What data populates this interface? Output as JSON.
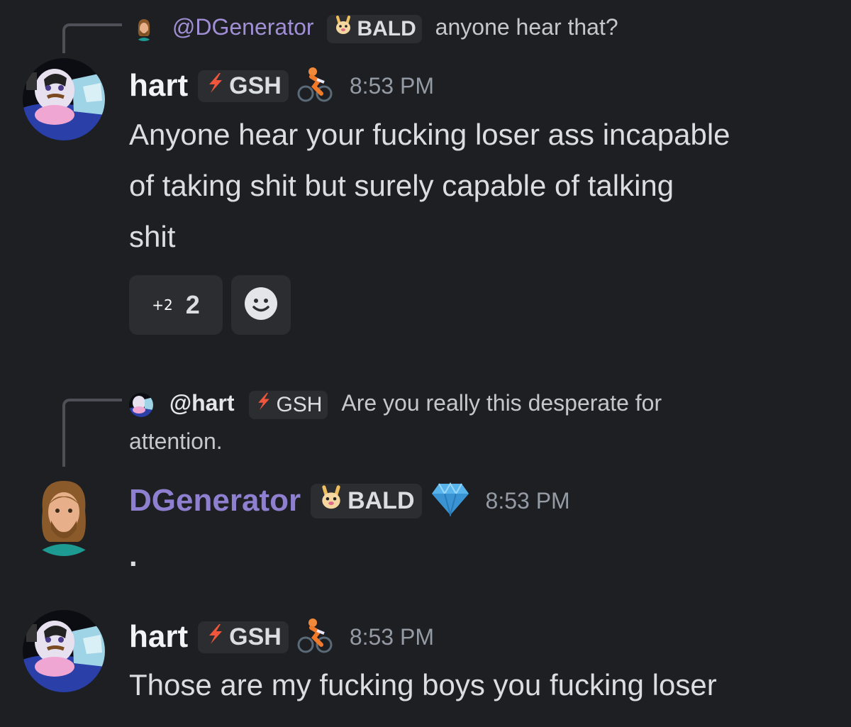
{
  "reply1": {
    "mention": "@DGenerator",
    "tag_label": "BALD",
    "text": "anyone hear that?"
  },
  "message1": {
    "username": "hart",
    "tag_label": "GSH",
    "timestamp": "8:53 PM",
    "line1": "Anyone hear your fucking loser ass incapable",
    "line2": "of taking shit but surely capable of talking",
    "line3": "shit",
    "reaction_emoji_text": "+2",
    "reaction_count": "2"
  },
  "reply2": {
    "mention": "@hart",
    "tag_label": "GSH",
    "text_line1": "Are you really this desperate for",
    "text_line2": "attention."
  },
  "message2": {
    "username": "DGenerator",
    "tag_label": "BALD",
    "timestamp": "8:53 PM",
    "text": "."
  },
  "message3": {
    "username": "hart",
    "tag_label": "GSH",
    "timestamp": "8:53 PM",
    "text": "Those are my fucking boys you fucking loser"
  },
  "colors": {
    "background": "#1e1f22",
    "dgenerator_name": "#8f7fd0",
    "mention_purple": "#a18fd6",
    "tag_bg": "#2b2d31",
    "lightning": "#f0563c"
  },
  "icons": [
    "lightning-icon",
    "bunny-icon",
    "cyclist-emoji",
    "gem-emoji",
    "add-reaction-smiley-icon"
  ]
}
